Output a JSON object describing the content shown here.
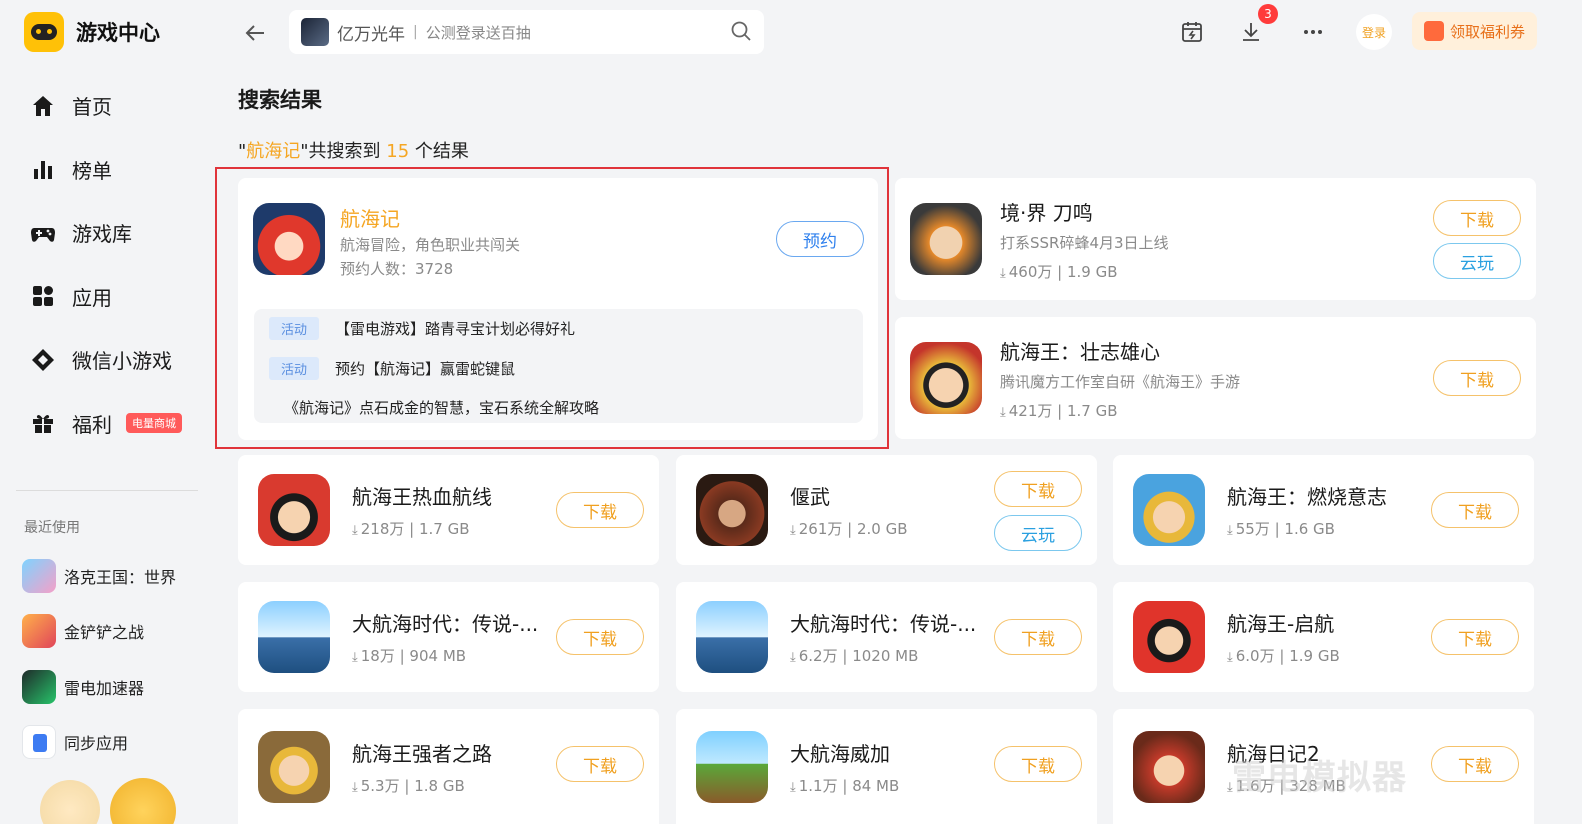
{
  "app": {
    "title": "游戏中心"
  },
  "nav": [
    {
      "label": "首页",
      "icon": "home-icon"
    },
    {
      "label": "榜单",
      "icon": "chart-icon"
    },
    {
      "label": "游戏库",
      "icon": "gamepad-icon"
    },
    {
      "label": "应用",
      "icon": "apps-icon"
    },
    {
      "label": "微信小游戏",
      "icon": "diamond-icon"
    },
    {
      "label": "福利",
      "icon": "gift-icon",
      "badge": "电量商城"
    }
  ],
  "recent": {
    "title": "最近使用",
    "items": [
      {
        "label": "洛克王国：世界"
      },
      {
        "label": "金铲铲之战"
      },
      {
        "label": "雷电加速器"
      },
      {
        "label": "同步应用"
      }
    ]
  },
  "search": {
    "keyword": "亿万光年",
    "placeholder": "公测登录送百抽"
  },
  "topbar": {
    "download_badge": "3",
    "login": "登录",
    "coupon": "领取福利券"
  },
  "main": {
    "title": "搜索结果",
    "result": {
      "prefix": "\"",
      "query": "航海记",
      "middle": "\"共搜索到 ",
      "count": "15",
      "suffix": " 个结果"
    }
  },
  "featured": {
    "name": "航海记",
    "desc": "航海冒险，角色职业共闯关",
    "count": "预约人数：3728",
    "button": "预约",
    "news": [
      {
        "tag": "活动",
        "text": "【雷电游戏】踏青寻宝计划必得好礼"
      },
      {
        "tag": "活动",
        "text": "预约【航海记】赢雷蛇键鼠"
      },
      {
        "tag": "",
        "text": "《航海记》点石成金的智慧，宝石系统全解攻略"
      }
    ]
  },
  "side_results": [
    {
      "name": "境·界 刀鸣",
      "desc": "打系SSR碎蜂4月3日上线",
      "meta": "460万 | 1.9 GB",
      "download": "下载",
      "cloud": "云玩"
    },
    {
      "name": "航海王：壮志雄心",
      "desc": "腾讯魔方工作室自研《航海王》手游",
      "meta": "421万 | 1.7 GB",
      "download": "下载"
    }
  ],
  "results": [
    {
      "name": "航海王热血航线",
      "meta": "218万 | 1.7 GB",
      "download": "下载"
    },
    {
      "name": "偃武",
      "meta": "261万 | 2.0 GB",
      "download": "下载",
      "cloud": "云玩"
    },
    {
      "name": "航海王：燃烧意志",
      "meta": "55万 | 1.6 GB",
      "download": "下载"
    },
    {
      "name": "大航海时代：传说-...",
      "meta": "18万 | 904 MB",
      "download": "下载"
    },
    {
      "name": "大航海时代：传说-...",
      "meta": "6.2万 | 1020 MB",
      "download": "下载"
    },
    {
      "name": "航海王-启航",
      "meta": "6.0万 | 1.9 GB",
      "download": "下载"
    },
    {
      "name": "航海王强者之路",
      "meta": "5.3万 | 1.8 GB",
      "download": "下载"
    },
    {
      "name": "大航海威加",
      "meta": "1.1万 | 84 MB",
      "download": "下载"
    },
    {
      "name": "航海日记2",
      "meta": "1.6万 | 328 MB",
      "download": "下载"
    }
  ],
  "watermark": "雷电模拟器",
  "colors": {
    "accent": "#f5a623",
    "highlight_border": "#e0343a",
    "cloud": "#2aa0e0",
    "reserve": "#2f80ed"
  }
}
